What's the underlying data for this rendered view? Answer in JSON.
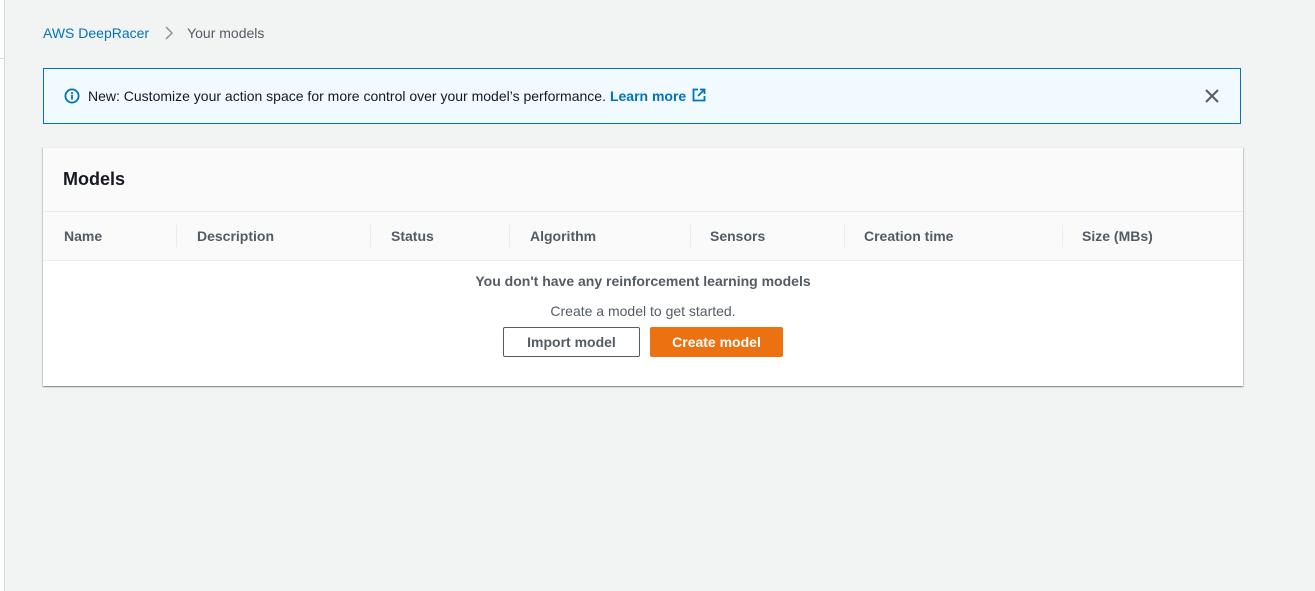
{
  "breadcrumb": {
    "root": "AWS DeepRacer",
    "current": "Your models"
  },
  "flash": {
    "icon": "info-icon",
    "message": "New: Customize your action space for more control over your model’s performance.",
    "link_label": "Learn more",
    "link_icon": "external-link-icon",
    "close_icon": "close-icon"
  },
  "models_panel": {
    "title": "Models",
    "columns": [
      "Name",
      "Description",
      "Status",
      "Algorithm",
      "Sensors",
      "Creation time",
      "Size (MBs)"
    ],
    "empty_title": "You don't have any reinforcement learning models",
    "empty_subtitle": "Create a model to get started.",
    "import_button": "Import model",
    "create_button": "Create model"
  },
  "colors": {
    "link": "#0073bb",
    "primary_button": "#ec7211",
    "flash_background": "#f1faff",
    "page_background": "#f2f3f3"
  }
}
